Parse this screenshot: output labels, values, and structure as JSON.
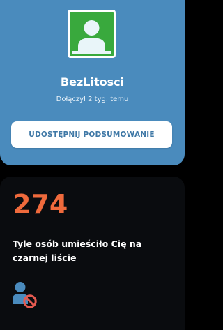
{
  "profile": {
    "avatar_icon": "default-user-avatar-icon",
    "username": "BezLitosci",
    "joined": "Dołączył 2 tyg. temu",
    "share_button": "UDOSTĘPNIJ PODSUMOWANIE"
  },
  "stat": {
    "value": "274",
    "description": "Tyle osób umieściło Cię na czarnej liście",
    "icon": "user-blocked-icon"
  },
  "colors": {
    "profile_bg": "#4a8bbd",
    "avatar_bg": "#39a93d",
    "accent_orange": "#ef6a3c",
    "icon_blue": "#4a8bbd",
    "block_red": "#e55a50"
  }
}
